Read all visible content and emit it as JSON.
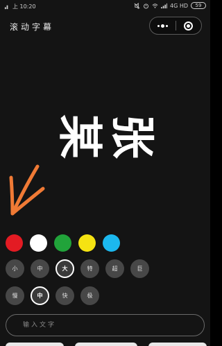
{
  "status_bar": {
    "time": "上 10:20",
    "network": "4G HD",
    "battery": "59"
  },
  "nav": {
    "title": "滚动字幕"
  },
  "caption": {
    "text": "张某"
  },
  "colors": [
    {
      "name": "red",
      "hex": "#e31b23"
    },
    {
      "name": "white",
      "hex": "#ffffff"
    },
    {
      "name": "green",
      "hex": "#21a33a"
    },
    {
      "name": "yellow",
      "hex": "#f5e312"
    },
    {
      "name": "cyan",
      "hex": "#1cb8ee"
    }
  ],
  "sizes": [
    {
      "label": "小",
      "selected": false
    },
    {
      "label": "中",
      "selected": false
    },
    {
      "label": "大",
      "selected": true
    },
    {
      "label": "特",
      "selected": false
    },
    {
      "label": "超",
      "selected": false
    },
    {
      "label": "巨",
      "selected": false
    }
  ],
  "speeds": [
    {
      "label": "慢",
      "selected": false
    },
    {
      "label": "中",
      "selected": true
    },
    {
      "label": "快",
      "selected": false
    },
    {
      "label": "极",
      "selected": false
    }
  ],
  "input": {
    "placeholder": "输入文字",
    "value": ""
  },
  "icons": {
    "menu": "more-dots-icon",
    "close": "target-icon"
  }
}
